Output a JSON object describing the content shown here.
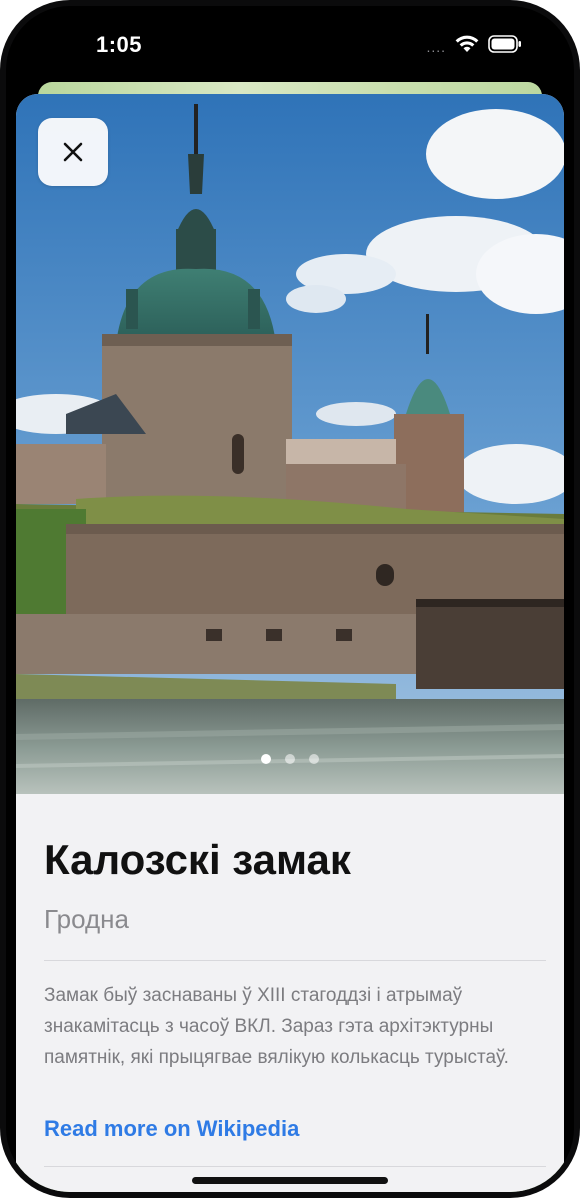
{
  "status_bar": {
    "time": "1:05",
    "signal": "....",
    "icons": [
      "wifi-icon",
      "battery-icon"
    ]
  },
  "place": {
    "title": "Калозскі замак",
    "city": "Гродна",
    "description": "Замак быў заснаваны ў XIII стагоддзі і атрымаў знакамітасць з часоў ВКЛ. Зараз гэта архітэктурны памятнік, які прыцягвае вялікую колькасць турыстаў.",
    "link_label": "Read more on Wikipedia",
    "image": {
      "pages_total": 3,
      "current_page": 1,
      "subject": "castle-photo"
    }
  },
  "colors": {
    "accent": "#2f7be5",
    "title": "#111111",
    "secondary_text": "#8a8a8e",
    "card_background": "#f2f2f4"
  }
}
